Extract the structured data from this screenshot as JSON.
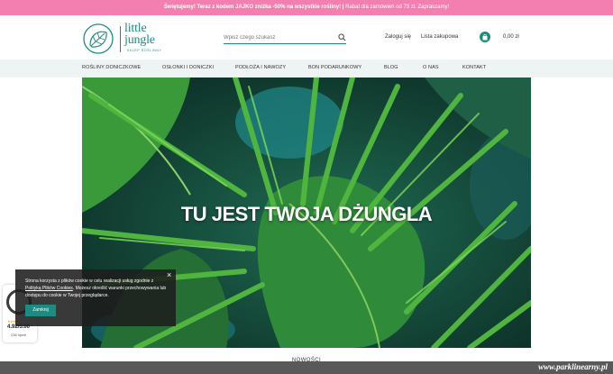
{
  "promo": {
    "bold": "Świętujemy! Teraz z kodem JAJKO zniżka -50% na wszystkie rośliny! |",
    "rest": " Rabat dla zamówień od 79 zł. Zapraszamy!"
  },
  "logo": {
    "line1": "little",
    "line2": "jungle",
    "sub": "SKLEP ROŚLINNY"
  },
  "search": {
    "placeholder": "Wpisz czego szukasz"
  },
  "header": {
    "login": "Zaloguj się",
    "wishlist": "Lista zakupowa",
    "cart_value": "0,00 zł"
  },
  "nav": {
    "items": [
      {
        "label": "ROŚLINY DONICZKOWE"
      },
      {
        "label": "OSŁONKI I DONICZKI"
      },
      {
        "label": "PODŁOŻA I NAWOZY"
      },
      {
        "label": "BON PODARUNKOWY"
      },
      {
        "label": "BLOG"
      },
      {
        "label": "O NAS"
      },
      {
        "label": "KONTAKT"
      }
    ]
  },
  "hero": {
    "title": "TU JEST TWOJA DŻUNGLA"
  },
  "section": {
    "title": "NOWOŚCI"
  },
  "cookie": {
    "text1": "Strona korzysta z plików cookie w celu realizacji usług zgodnie z ",
    "link": "Polityką Plików Cookies",
    "text2": ". Możesz określić warunki przechowywania lub dostępu do cookie w Twojej przeglądarce.",
    "close": "×",
    "button": "Zamknij"
  },
  "badge": {
    "stars": "★★★★★",
    "rating": "4.92/5.00",
    "count": "236 opinii"
  },
  "watermark": "www.parklinearny.pl",
  "colors": {
    "accent": "#1c8c82",
    "promo": "#f37eb0",
    "nav_bg": "#eef3f4"
  }
}
